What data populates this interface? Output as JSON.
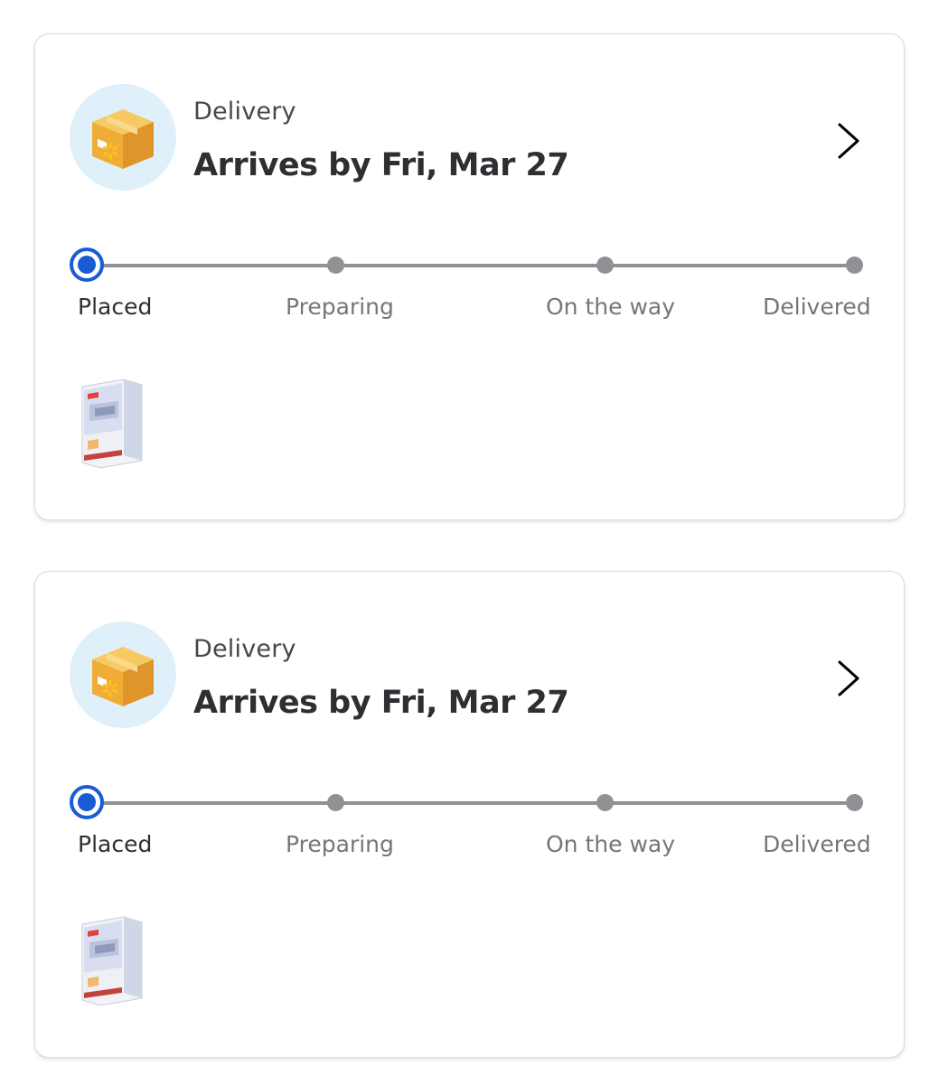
{
  "orders": [
    {
      "label": "Delivery",
      "title": "Arrives by Fri, Mar 27",
      "icon": "package-box-icon",
      "steps": [
        {
          "label": "Placed",
          "active": true
        },
        {
          "label": "Preparing",
          "active": false
        },
        {
          "label": "On the way",
          "active": false
        },
        {
          "label": "Delivered",
          "active": false
        }
      ],
      "item_image": "pokemon-card-box-thumbnail"
    },
    {
      "label": "Delivery",
      "title": "Arrives by Fri, Mar 27",
      "icon": "package-box-icon",
      "steps": [
        {
          "label": "Placed",
          "active": true
        },
        {
          "label": "Preparing",
          "active": false
        },
        {
          "label": "On the way",
          "active": false
        },
        {
          "label": "Delivered",
          "active": false
        }
      ],
      "item_image": "pokemon-card-box-thumbnail"
    }
  ],
  "colors": {
    "accent": "#1b5bd6",
    "track": "#8f9194",
    "icon_bg": "#dff0fa",
    "box": "#f2b233",
    "spark": "#ffc220"
  }
}
